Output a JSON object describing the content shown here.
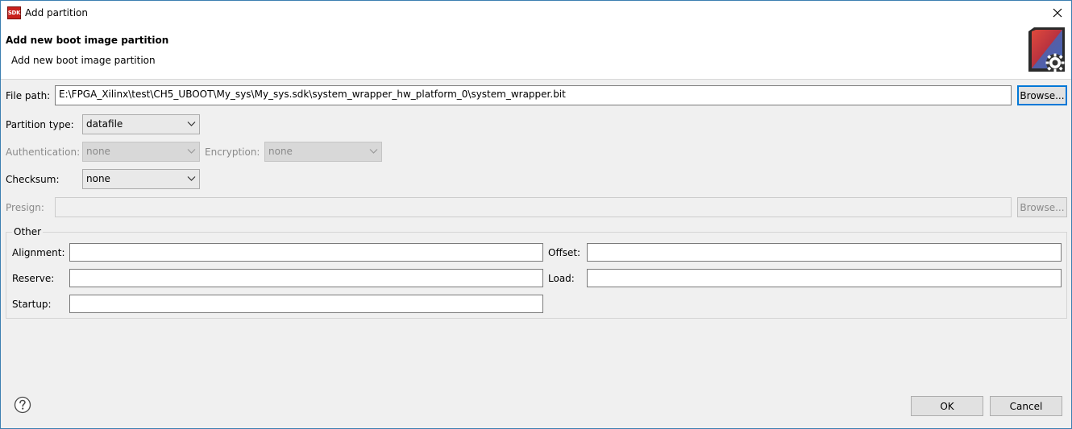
{
  "window": {
    "title": "Add partition",
    "app_icon_text": "SDK"
  },
  "header": {
    "title": "Add new boot image partition",
    "description": "Add new boot image partition"
  },
  "form": {
    "file_path": {
      "label": "File path:",
      "value": "E:\\FPGA_Xilinx\\test\\CH5_UBOOT\\My_sys\\My_sys.sdk\\system_wrapper_hw_platform_0\\system_wrapper.bit",
      "browse_label": "Browse..."
    },
    "partition_type": {
      "label": "Partition type:",
      "value": "datafile"
    },
    "authentication": {
      "label": "Authentication:",
      "value": "none"
    },
    "encryption": {
      "label": "Encryption:",
      "value": "none"
    },
    "checksum": {
      "label": "Checksum:",
      "value": "none"
    },
    "presign": {
      "label": "Presign:",
      "value": "",
      "browse_label": "Browse..."
    }
  },
  "other": {
    "group_label": "Other",
    "alignment": {
      "label": "Alignment:",
      "value": ""
    },
    "offset": {
      "label": "Offset:",
      "value": ""
    },
    "reserve": {
      "label": "Reserve:",
      "value": ""
    },
    "load": {
      "label": "Load:",
      "value": ""
    },
    "startup": {
      "label": "Startup:",
      "value": ""
    }
  },
  "footer": {
    "ok_label": "OK",
    "cancel_label": "Cancel",
    "help_icon": "help-icon"
  },
  "colors": {
    "focus_border": "#0078d7",
    "window_border": "#3c7fb1",
    "dialog_bg": "#f0f0f0"
  }
}
